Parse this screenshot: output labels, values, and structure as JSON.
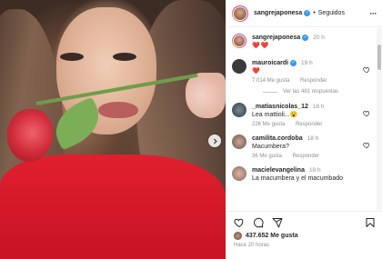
{
  "post": {
    "author": "sangrejaponesa",
    "follow_status": "Seguidos",
    "caption_time": "20 h",
    "caption_text": "❤️❤️"
  },
  "comments": [
    {
      "user": "mauroicardi",
      "time": "19 h",
      "text": "❤️",
      "likes": "7.014 Me gusta",
      "reply_label": "Responder",
      "view_replies": "Ver las 481 respuestas"
    },
    {
      "user": "_matiasnicolas_12",
      "time": "16 h",
      "text": "Lea mattioli...😮",
      "likes": "226 Me gusta",
      "reply_label": "Responder"
    },
    {
      "user": "camilita.cordoba",
      "time": "18 h",
      "text": "Macumbera?",
      "likes": "36 Me gusta",
      "reply_label": "Responder"
    },
    {
      "user": "macielevangelina",
      "time": "19 h",
      "text": "La macumbera y el macumbado"
    }
  ],
  "footer": {
    "likes_count": "437.652 Me gusta",
    "posted_ago": "Hace 20 horas"
  },
  "icons": {
    "like": "heart-icon",
    "comment": "comment-icon",
    "share": "share-icon",
    "save": "bookmark-icon",
    "more": "more-icon",
    "next": "chevron-right-icon",
    "verified": "verified-icon"
  },
  "colors": {
    "like_red": "#ed4956",
    "verified_blue": "#3897f0",
    "muted_text": "#8e8e8e"
  }
}
